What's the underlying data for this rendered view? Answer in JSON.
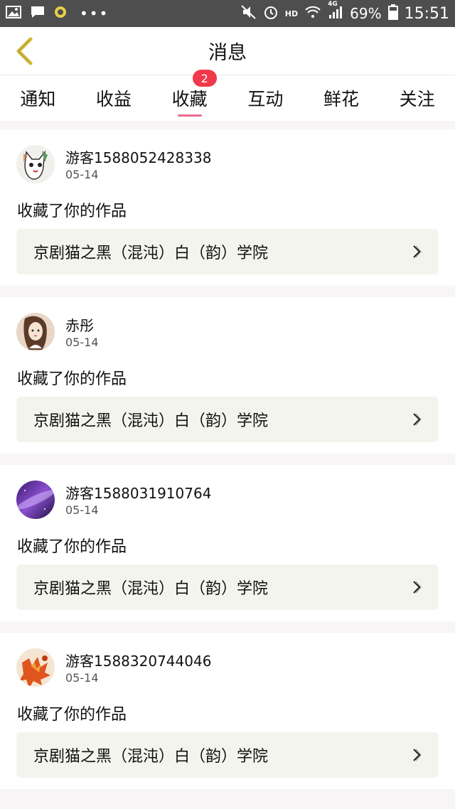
{
  "status_bar": {
    "left_icons": [
      "image-icon",
      "chat-icon",
      "app-icon"
    ],
    "dots": "•••",
    "hd": "HD",
    "network": "4G",
    "battery": "69%",
    "time": "15:51"
  },
  "header": {
    "title": "消息",
    "back_icon": "chevron-left-icon"
  },
  "tabs": [
    {
      "label": "通知",
      "active": false
    },
    {
      "label": "收益",
      "active": false
    },
    {
      "label": "收藏",
      "active": true,
      "badge": "2"
    },
    {
      "label": "互动",
      "active": false
    },
    {
      "label": "鲜花",
      "active": false
    },
    {
      "label": "关注",
      "active": false
    }
  ],
  "colors": {
    "accent_underline": "#ea6a8d",
    "badge_red": "#f0394a",
    "back_chevron": "#d4b83a",
    "work_bg": "#f4f4ee"
  },
  "messages": [
    {
      "user": "游客1588052428338",
      "date": "05-14",
      "action": "收藏了你的作品",
      "work": "京剧猫之黑（混沌）白（韵）学院",
      "avatar": "opera-mask-avatar"
    },
    {
      "user": "赤彤",
      "date": "05-14",
      "action": "收藏了你的作品",
      "work": "京剧猫之黑（混沌）白（韵）学院",
      "avatar": "illustrated-girl-avatar"
    },
    {
      "user": "游客1588031910764",
      "date": "05-14",
      "action": "收藏了你的作品",
      "work": "京剧猫之黑（混沌）白（韵）学院",
      "avatar": "galaxy-avatar"
    },
    {
      "user": "游客1588320744046",
      "date": "05-14",
      "action": "收藏了你的作品",
      "work": "京剧猫之黑（混沌）白（韵）学院",
      "avatar": "autumn-leaves-avatar"
    }
  ]
}
